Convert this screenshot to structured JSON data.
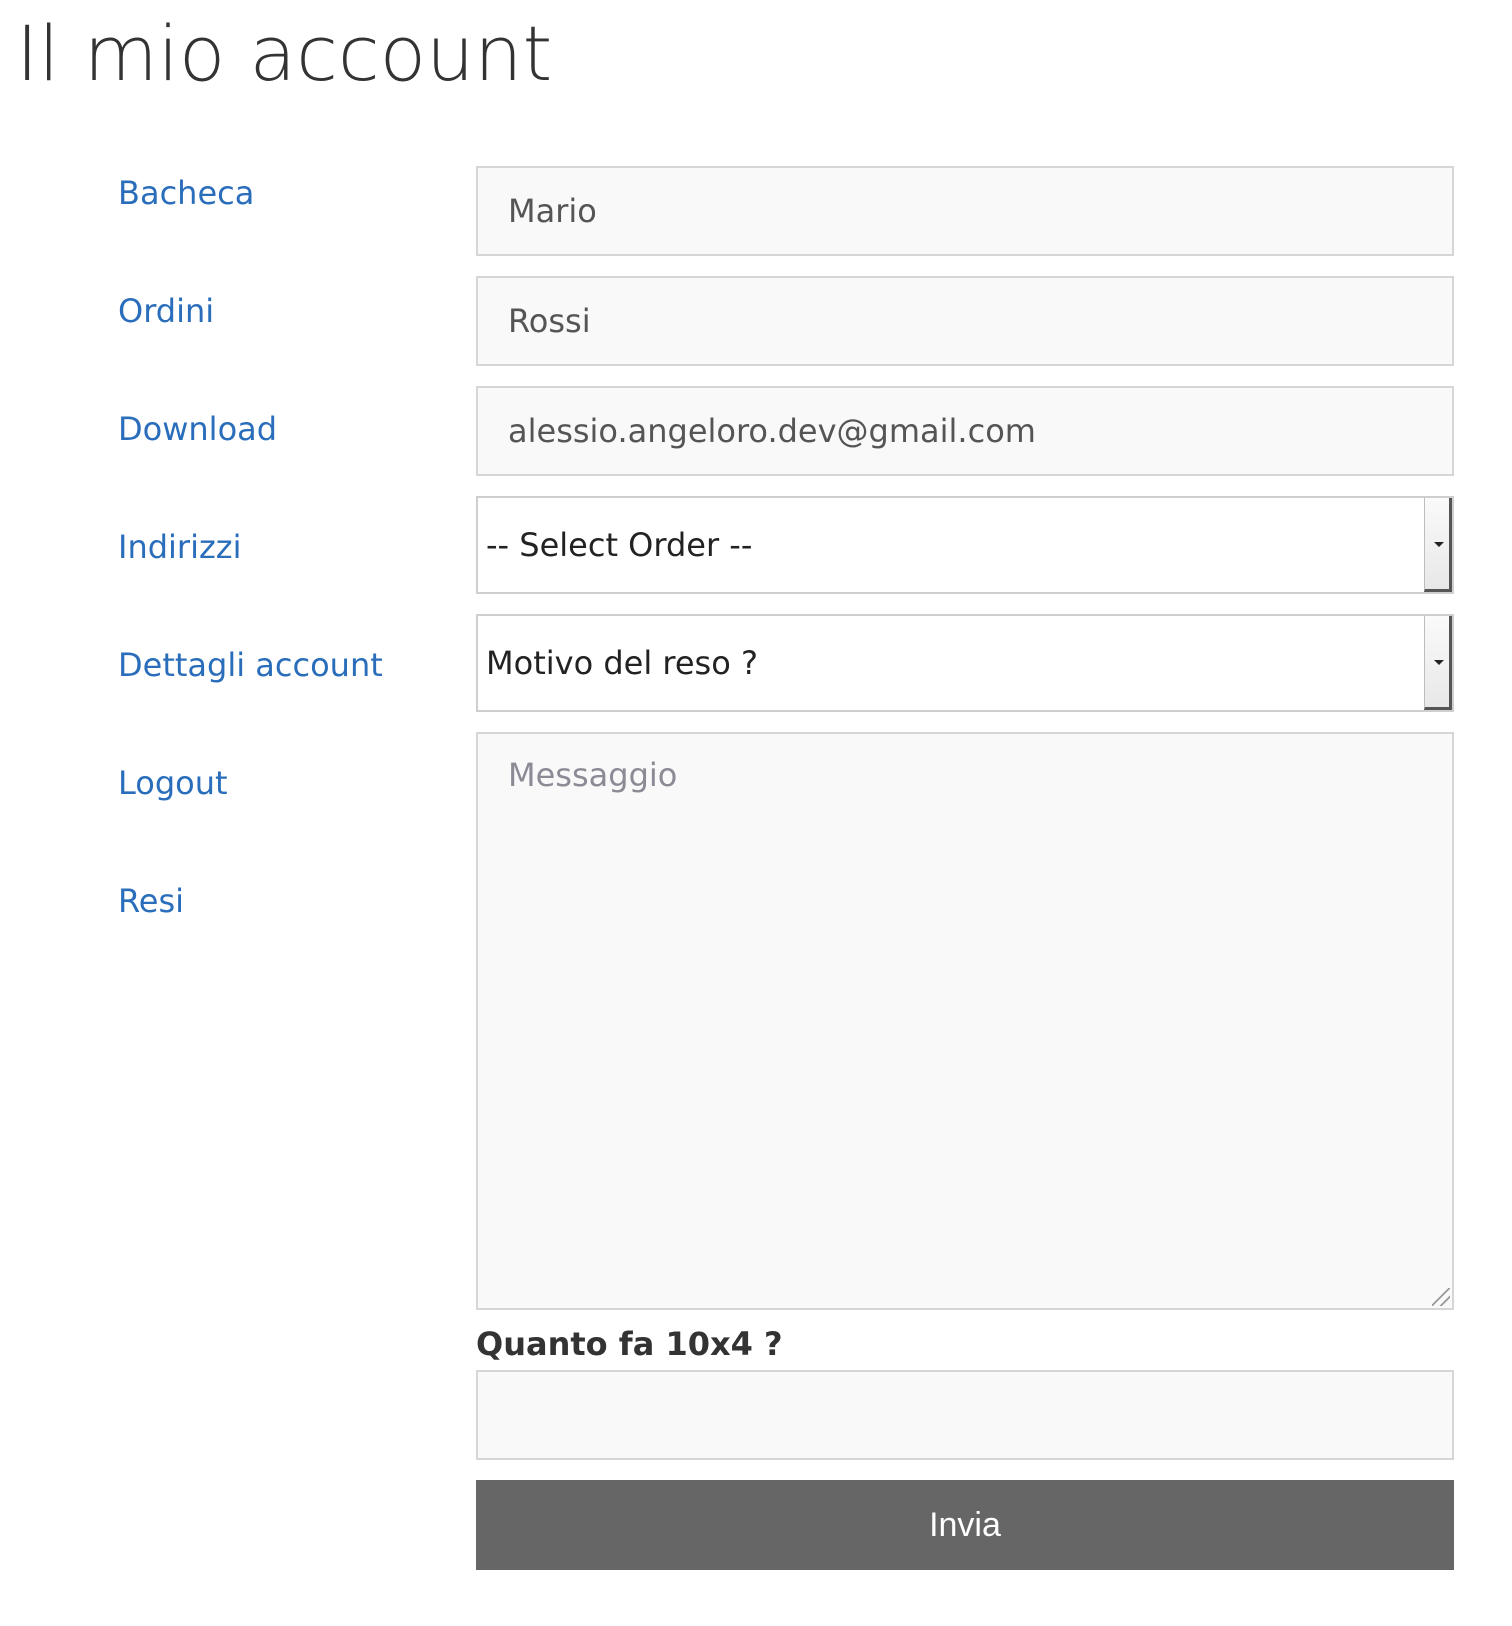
{
  "page": {
    "title": "Il mio account"
  },
  "sidebar": {
    "items": [
      {
        "label": "Bacheca"
      },
      {
        "label": "Ordini"
      },
      {
        "label": "Download"
      },
      {
        "label": "Indirizzi"
      },
      {
        "label": "Dettagli account"
      },
      {
        "label": "Logout"
      },
      {
        "label": "Resi"
      }
    ]
  },
  "form": {
    "first_name": {
      "value": "Mario"
    },
    "last_name": {
      "value": "Rossi"
    },
    "email": {
      "value": "alessio.angeloro.dev@gmail.com"
    },
    "order_select": {
      "selected": "-- Select Order --"
    },
    "reason_select": {
      "selected": "Motivo del reso ?"
    },
    "message": {
      "placeholder": "Messaggio"
    },
    "captcha": {
      "label": "Quanto fa 10x4 ?",
      "value": ""
    },
    "submit_label": "Invia"
  },
  "colors": {
    "link": "#2a6ebb",
    "button_bg": "#666666",
    "field_bg": "#f9f9f9",
    "field_border": "#d6d6d6"
  },
  "icons": {
    "select_arrow": "chevron-down-icon",
    "resize_grip": "resize-grip-icon"
  }
}
